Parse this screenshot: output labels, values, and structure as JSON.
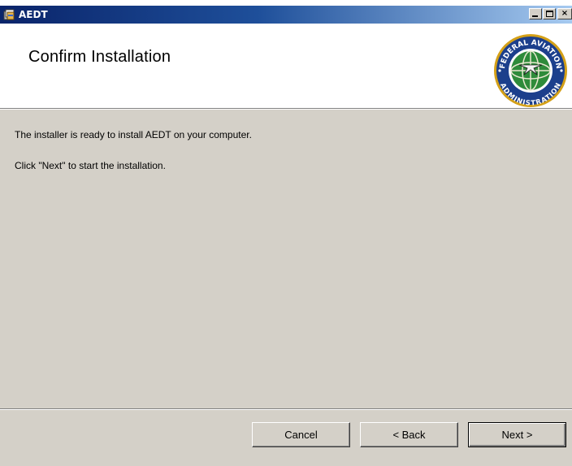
{
  "window": {
    "title": "AEDT",
    "title_bar_color": "#0a246a"
  },
  "banner": {
    "heading": "Confirm Installation",
    "logo": {
      "top_text": "FEDERAL AVIATION",
      "bottom_text": "ADMINISTRATION",
      "colors": {
        "ring": "#1c3f8c",
        "globe": "#2e8b3a",
        "accent": "#d4a017"
      }
    }
  },
  "body": {
    "line1": "The installer is ready to install AEDT on your computer.",
    "line2": "Click \"Next\" to start the installation."
  },
  "buttons": {
    "cancel": "Cancel",
    "back": "< Back",
    "next": "Next >"
  },
  "icons": {
    "app": "installer-icon",
    "minimize": "minimize-icon",
    "maximize": "maximize-icon",
    "close": "close-icon"
  }
}
